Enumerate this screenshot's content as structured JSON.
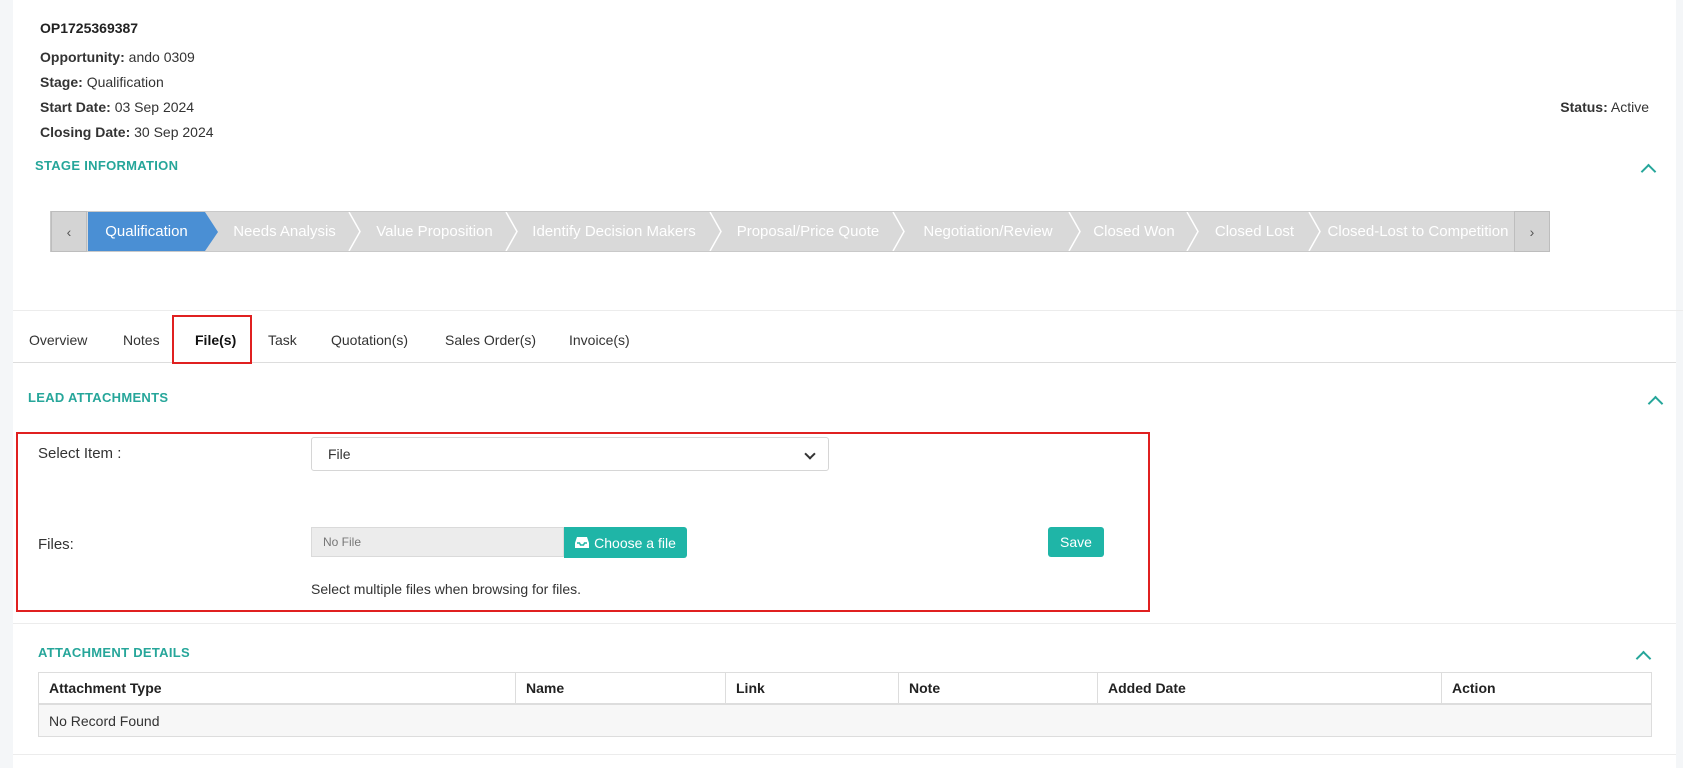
{
  "header": {
    "opportunity_id": "OP1725369387",
    "opportunity_label": "Opportunity:",
    "opportunity_value": "ando 0309",
    "stage_label": "Stage:",
    "stage_value": "Qualification",
    "start_label": "Start Date:",
    "start_value": "03 Sep 2024",
    "closing_label": "Closing Date:",
    "closing_value": "30 Sep 2024",
    "status_label": "Status:",
    "status_value": "Active"
  },
  "stage_info": {
    "title": "STAGE INFORMATION",
    "prev_icon": "chevron-left-icon",
    "next_icon": "chevron-right-icon",
    "stages": [
      "Qualification",
      "Needs Analysis",
      "Value Proposition",
      "Identify Decision Makers",
      "Proposal/Price Quote",
      "Negotiation/Review",
      "Closed Won",
      "Closed Lost",
      "Closed-Lost to Competition"
    ],
    "active_index": 0
  },
  "tabs": [
    "Overview",
    "Notes",
    "File(s)",
    "Task",
    "Quotation(s)",
    "Sales Order(s)",
    "Invoice(s)"
  ],
  "active_tab": "File(s)",
  "lead_attachments": {
    "title": "LEAD ATTACHMENTS",
    "select_label": "Select Item :",
    "select_value": "File",
    "files_label": "Files:",
    "file_placeholder": "No File",
    "choose_label": "Choose a file",
    "choose_icon": "inbox-icon",
    "save_label": "Save",
    "hint": "Select multiple files when browsing for files."
  },
  "attachment_details": {
    "title": "ATTACHMENT DETAILS",
    "columns": [
      "Attachment Type",
      "Name",
      "Link",
      "Note",
      "Added Date",
      "Action"
    ],
    "empty_message": "No Record Found"
  },
  "colors": {
    "accent": "#26a69a",
    "button": "#1fb5a7",
    "active_stage": "#4a8fd4",
    "inactive_stage": "#d9d9d9",
    "highlight": "#e02020"
  }
}
